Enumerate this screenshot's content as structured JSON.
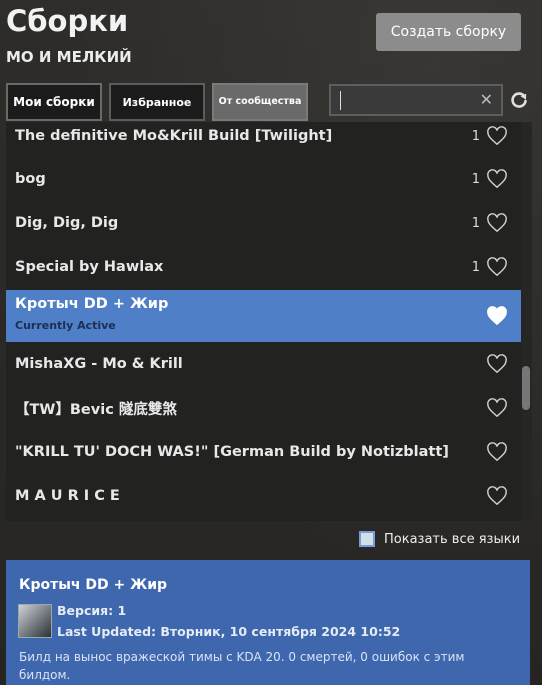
{
  "header": {
    "title": "Сборки",
    "subtitle": "МО И МЕЛКИЙ",
    "create_button": "Создать сборку"
  },
  "tabs": [
    {
      "label": "Мои сборки"
    },
    {
      "label": "Избранное"
    },
    {
      "label": "От сообщества"
    }
  ],
  "search": {
    "value": "",
    "clear_icon": "close-icon",
    "refresh_icon": "refresh-icon"
  },
  "builds": [
    {
      "name": "The definitive Mo&Krill Build [Twilight]",
      "count": "1",
      "active": false
    },
    {
      "name": "bog",
      "count": "1",
      "active": false
    },
    {
      "name": "Dig, Dig, Dig",
      "count": "1",
      "active": false
    },
    {
      "name": "Special by Hawlax",
      "count": "1",
      "active": false
    },
    {
      "name": "Кротыч DD + Жир",
      "count": "",
      "active": true,
      "status": "Currently Active"
    },
    {
      "name": "MishaXG - Mo & Krill",
      "count": "",
      "active": false
    },
    {
      "name": "【TW】Bevic 隧底雙煞",
      "count": "",
      "active": false
    },
    {
      "name": "\"KRILL TU' DOCH WAS!\" [German Build by Notizblatt]",
      "count": "",
      "active": false
    },
    {
      "name": "M A U R I C E",
      "count": "",
      "active": false
    }
  ],
  "language_filter": {
    "label": "Показать все языки",
    "checked": false
  },
  "details": {
    "title": "Кротыч DD + Жир",
    "version": "Версия: 1",
    "last_updated": "Last Updated: Вторник, 10 сентября 2024 10:52",
    "description": "Билд на вынос вражеской тимы с KDA 20. 0 смертей, 0 ошибок с этим билдом."
  },
  "colors": {
    "accent": "#4f7fc7",
    "panel": "#3e67ad",
    "background": "#2b2a28"
  }
}
